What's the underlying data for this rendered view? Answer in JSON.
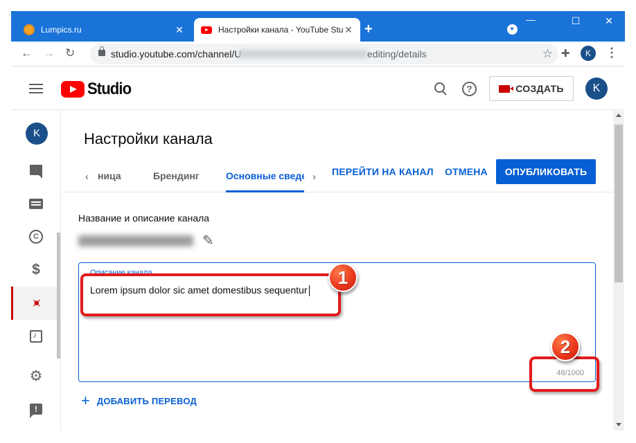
{
  "browser": {
    "tabs": [
      {
        "title": "Lumpics.ru",
        "active": false
      },
      {
        "title": "Настройки канала - YouTube Studio",
        "active": true
      }
    ],
    "new_tab": "+",
    "url": "studio.youtube.com/channel/U",
    "url_tail": "editing/details",
    "profile_initial": "K"
  },
  "header": {
    "logo_text": "Studio",
    "create_label": "СОЗДАТЬ",
    "avatar_initial": "K"
  },
  "sidebar": {
    "avatar_initial": "K",
    "items": [
      {
        "name": "comments-icon"
      },
      {
        "name": "subtitles-icon"
      },
      {
        "name": "copyright-icon"
      },
      {
        "name": "monetization-icon"
      },
      {
        "name": "customization-icon",
        "active": true
      },
      {
        "name": "audio-library-icon"
      },
      {
        "name": "settings-icon"
      },
      {
        "name": "feedback-icon"
      }
    ]
  },
  "page": {
    "title": "Настройки канала",
    "tabs": [
      "ница",
      "Брендинг",
      "Основные сведения"
    ],
    "go_to_channel": "ПЕРЕЙТИ НА КАНАЛ",
    "cancel": "ОТМЕНА",
    "publish": "ОПУБЛИКОВАТЬ",
    "section_title": "Название и описание канала",
    "description_label": "Описание канала",
    "description_value": "Lorem ipsum dolor sic amet domestibus sequentur",
    "counter": "48/1000",
    "add_translation": "ДОБАВИТЬ ПЕРЕВОД"
  },
  "annotations": {
    "badge1": "1",
    "badge2": "2"
  },
  "colors": {
    "accent": "#065fd4",
    "brand_red": "#ff0000",
    "annotation_red": "#e31b1b",
    "titlebar": "#1a73d9"
  }
}
